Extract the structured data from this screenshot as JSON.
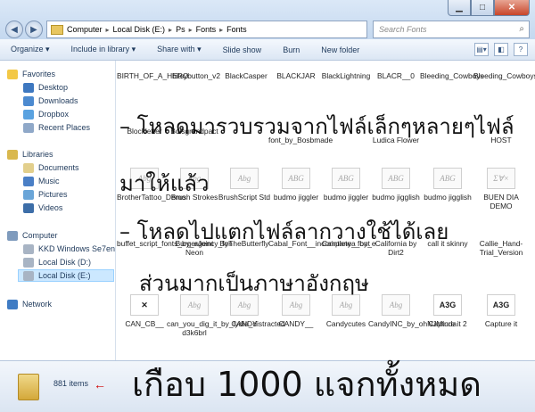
{
  "window": {
    "minimize": "▁",
    "maximize": "□",
    "close": "✕"
  },
  "address": {
    "breadcrumbs": [
      "Computer",
      "Local Disk (E:)",
      "Ps",
      "Fonts",
      "Fonts"
    ],
    "separator": "▸",
    "refresh": "↻"
  },
  "search": {
    "placeholder": "Search Fonts",
    "icon": "search-icon"
  },
  "toolbar": {
    "organize": "Organize ▾",
    "include": "Include in library ▾",
    "share": "Share with ▾",
    "slideshow": "Slide show",
    "burn": "Burn",
    "newfolder": "New folder",
    "views": "▤▾",
    "pane": "◧",
    "help": "?"
  },
  "nav": {
    "favorites": "Favorites",
    "desktop": "Desktop",
    "downloads": "Downloads",
    "dropbox": "Dropbox",
    "recent": "Recent Places",
    "libraries": "Libraries",
    "documents": "Documents",
    "music": "Music",
    "pictures": "Pictures",
    "videos": "Videos",
    "computer": "Computer",
    "kkd": "KKD Windows Se7en",
    "diskd": "Local Disk (D:)",
    "diske": "Local Disk (E:)",
    "network": "Network"
  },
  "files": {
    "row1": [
      "BIRTH_OF_A_HERO",
      "bitsybutton_v2",
      "BlackCasper",
      "BLACKJAR",
      "BlackLightning",
      "BLACR__0",
      "Bleeding_Cowboys",
      "Bleeding_Cowboys_0"
    ],
    "row2": [
      "Blockletter",
      "Boisgrandpact",
      "",
      "",
      "",
      "Ludica Flower",
      "",
      "HOST"
    ],
    "row2b": [
      "font_by_Bosbmade"
    ],
    "row3": [
      "BrotherTattoo_Demo",
      "Brush Strokes",
      "BrushScript Std",
      "budmo jiggler",
      "budmo jiggler",
      "budmo jigglish",
      "budmo jigglish",
      "BUEN DIA DEMO"
    ],
    "row4": [
      "buffet_script_fonts_by_agency_fon",
      "BurgerJoint Neon",
      "ByTheButterfly",
      "Cabal_Font__incomplete__by_e",
      "Caintanya font",
      "California by Dirt2",
      "call it skinny",
      "Callie_Hand-Trial_Version"
    ],
    "row5": [
      "CAN_CB__",
      "can_you_dig_it_by_lydia_distracted-d3k6brl",
      "CANDY",
      "CANDY__",
      "Candycutes",
      "CandyINC_by_ohNJMinda",
      "Capture it 2",
      "Capture it"
    ],
    "previews": {
      "abg": "Abg",
      "abg_caps": "ABG",
      "sigma": "Σ∀×",
      "a3g": "A3G",
      "abc": "ABC",
      "x": "✕"
    }
  },
  "overlay": {
    "line1": "– โหลดมารวบรวมจากไฟล์เล็กๆหลายๆไฟล์",
    "line2": "มาให้แล้ว",
    "line3": "– โหลดไปแตกไฟล์ลากวางใช้ได้เลย",
    "line4": "ส่วนมากเป็นภาษาอังกฤษ",
    "line5": "เกือบ 1000 แจกทั้งหมด"
  },
  "status": {
    "count": "881 items",
    "arrow": "←"
  },
  "colors": {
    "selection": "#cce8ff",
    "arrow": "#d10000"
  }
}
